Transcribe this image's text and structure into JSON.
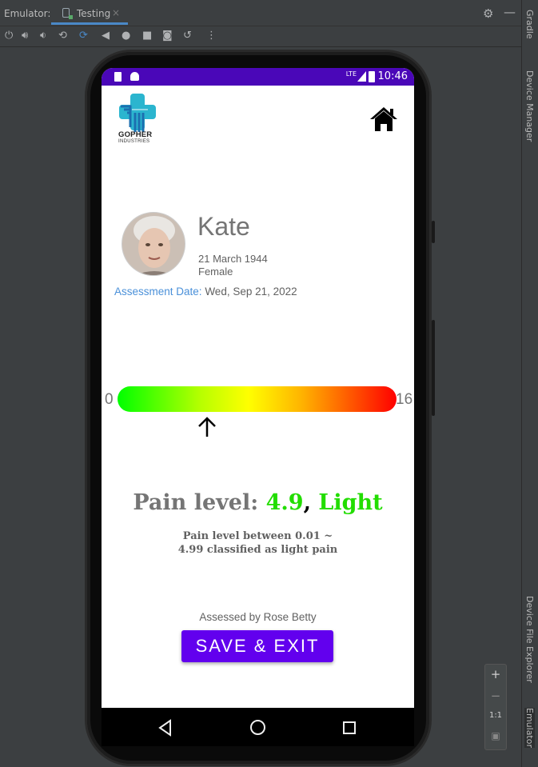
{
  "ide": {
    "emulator_label": "Emulator:",
    "active_tab": "Testing",
    "tab_close": "×",
    "right_tools": [
      "Gradle",
      "Device Manager",
      "Device File Explorer",
      "Emulator"
    ],
    "toolbar_icons": [
      "power-icon",
      "volume-up-icon",
      "volume-down-icon",
      "rotate-left-icon",
      "rotate-right-icon",
      "back-icon",
      "home-icon",
      "overview-icon",
      "screenshot-icon",
      "snapshot-icon",
      "more-icon"
    ],
    "zoom": {
      "plus": "+",
      "minus": "−",
      "one_to_one": "1:1"
    }
  },
  "device": {
    "status_time": "10:46",
    "status_network": "LTE"
  },
  "app": {
    "logo_line1": "GOPHER",
    "logo_line2": "INDUSTRIES",
    "patient": {
      "name": "Kate",
      "dob": "21 March 1944",
      "gender": "Female"
    },
    "assessment": {
      "date_label": "Assessment Date:",
      "date_value": "Wed, Sep 21, 2022"
    },
    "scale": {
      "min": "0",
      "max": "16",
      "value": 4.9,
      "max_value": 16
    },
    "pain": {
      "label": "Pain level:",
      "value": "4.9",
      "separator": ",",
      "category": "Light",
      "description_line1": "Pain level between 0.01 ~",
      "description_line2": "4.99 classified as light pain"
    },
    "assessed_by": "Assessed by Rose Betty",
    "save_button": "SAVE & EXIT"
  },
  "colors": {
    "primary": "#6200ee",
    "status_bar": "#4a07b8",
    "pain_green": "#22dd00",
    "date_label_blue": "#4a90d9"
  }
}
